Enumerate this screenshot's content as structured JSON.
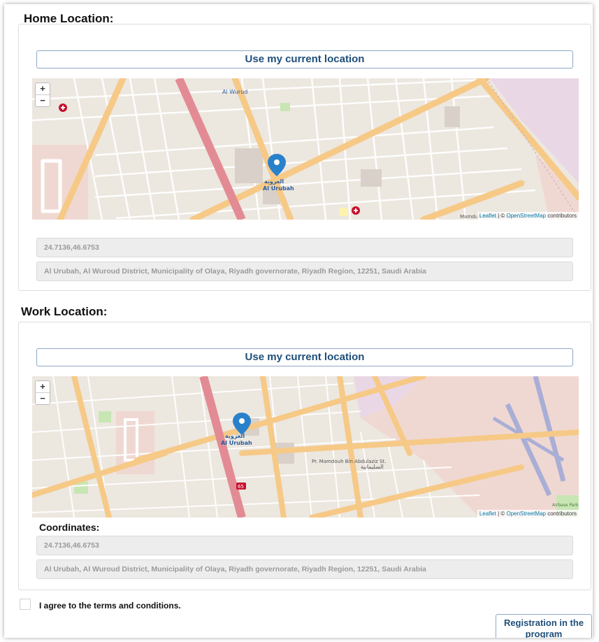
{
  "home": {
    "title": "Home Location:",
    "button_label": "Use my current location",
    "map": {
      "zoom_in": "+",
      "zoom_out": "−",
      "attribution_leaflet": "Leaflet",
      "attribution_sep": " | © ",
      "attribution_osm": "OpenStreetMap",
      "attribution_suffix": " contributors",
      "marker_label_ar": "العروبة",
      "marker_label_en": "Al Urubah",
      "district_label": "Al Wurud",
      "street_label": "Mamduh Bin Abdulaziz St."
    },
    "coordinates_value": "24.7136,46.6753",
    "address_value": "Al Urubah, Al Wuroud District, Municipality of Olaya, Riyadh governorate, Riyadh Region, 12251, Saudi Arabia"
  },
  "work": {
    "title": "Work Location:",
    "button_label": "Use my current location",
    "map": {
      "zoom_in": "+",
      "zoom_out": "−",
      "attribution_leaflet": "Leaflet",
      "attribution_sep": " | © ",
      "attribution_osm": "OpenStreetMap",
      "attribution_suffix": " contributors",
      "marker_label_ar": "العروبة",
      "marker_label_en": "Al Urubah",
      "street_label": "Pr. Mamdouh Bin Abdulaziz St.",
      "district_ar": "السليمانية",
      "park_label": "Airbase Park",
      "road_number": "65"
    },
    "coordinates_label": "Coordinates:",
    "coordinates_value": "24.7136,46.6753",
    "address_value": "Al Urubah, Al Wuroud District, Municipality of Olaya, Riyadh governorate, Riyadh Region, 12251, Saudi Arabia"
  },
  "terms": {
    "label": "I agree to the terms and conditions.",
    "checked": false
  },
  "register_button": "Registration in the program",
  "colors": {
    "accent": "#1f4e79",
    "button_border": "#8fa8c6",
    "field_bg": "#ededed",
    "marker": "#2a81cb",
    "major_road": "#f6c987",
    "highway": "#e38b94"
  }
}
